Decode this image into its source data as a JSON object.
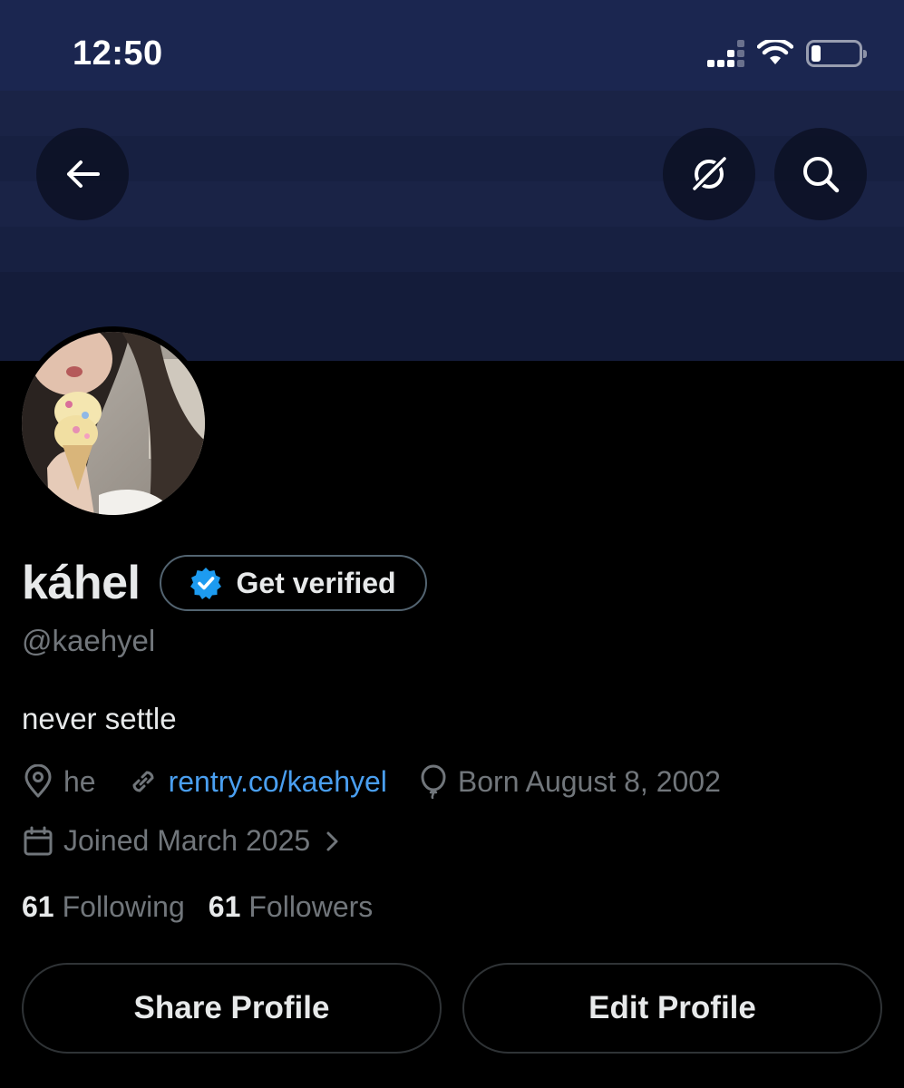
{
  "status_bar": {
    "time": "12:50"
  },
  "header": {
    "back_icon": "arrow-left-icon",
    "grok_icon": "grok-icon",
    "search_icon": "search-icon"
  },
  "profile": {
    "display_name": "káhel",
    "verify_label": "Get verified",
    "handle": "@kaehyel",
    "bio": "never settle",
    "location": "he",
    "website": "rentry.co/kaehyel",
    "birthday": "Born August 8, 2002",
    "joined": "Joined March 2025",
    "following_count": "61",
    "following_label": "Following",
    "followers_count": "61",
    "followers_label": "Followers"
  },
  "actions": {
    "share_label": "Share Profile",
    "edit_label": "Edit Profile"
  },
  "colors": {
    "link": "#4a9ff0",
    "verified_badge": "#1d9bf0",
    "muted_text": "#71767b",
    "banner": "#1a2346"
  }
}
